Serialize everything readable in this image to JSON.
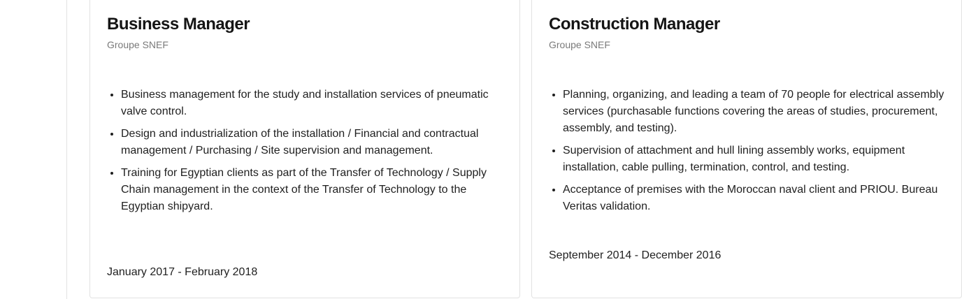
{
  "experience": [
    {
      "title": "Business Manager",
      "company": "Groupe SNEF",
      "bullets": [
        "Business management for the study and installation services of pneumatic valve control.",
        "Design and industrialization of the installation / Financial and contractual management / Purchasing / Site supervision and management.",
        "Training for Egyptian clients as part of the Transfer of Technology / Supply Chain management in the context of the Transfer of Technology to the Egyptian shipyard."
      ],
      "dates": "January 2017 - February 2018"
    },
    {
      "title": "Construction Manager",
      "company": "Groupe SNEF",
      "bullets": [
        "Planning, organizing, and leading a team of 70 people for electrical assembly services (purchasable functions covering the areas of studies, procurement, assembly, and testing).",
        "Supervision of attachment and hull lining assembly works, equipment installation, cable pulling, termination, control, and testing.",
        "Acceptance of premises with the Moroccan naval client and PRIOU. Bureau Veritas validation."
      ],
      "dates": "September 2014 - December 2016"
    }
  ]
}
